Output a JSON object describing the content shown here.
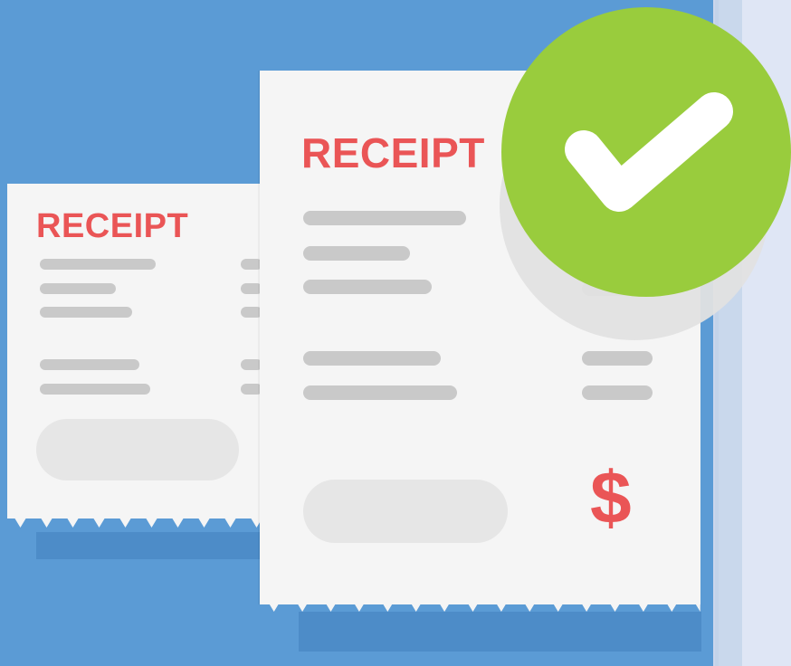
{
  "receipts": [
    {
      "title": "RECEIPT"
    },
    {
      "title": "RECEIPT",
      "currency_symbol": "$"
    }
  ],
  "badge": {
    "icon": "check-icon"
  },
  "colors": {
    "background": "#5b9bd5",
    "receipt_paper": "#f5f5f5",
    "accent_red": "#ea5556",
    "check_green": "#99cc3d",
    "placeholder_line": "#c9c9c9",
    "placeholder_pill": "#e6e6e6",
    "panel": "#dfe6f5"
  }
}
